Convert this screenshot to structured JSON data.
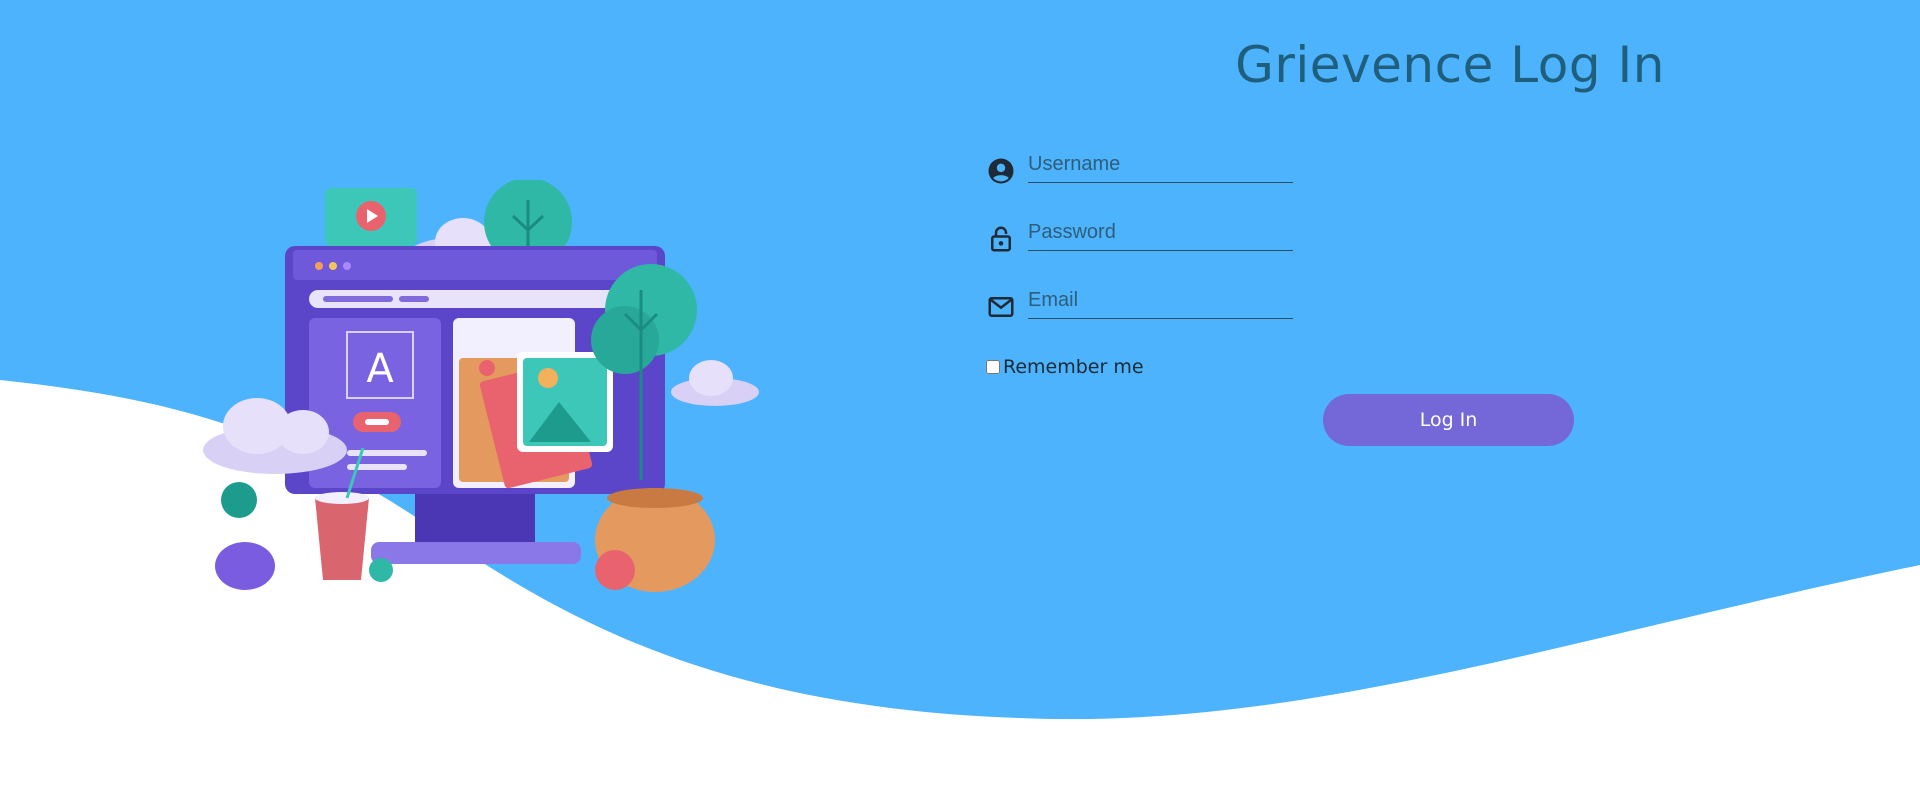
{
  "page": {
    "title": "Grievence Log In"
  },
  "form": {
    "username": {
      "value": "",
      "placeholder": "Username",
      "icon": "account-circle-icon"
    },
    "password": {
      "value": "",
      "placeholder": "Password",
      "icon": "lock-open-icon"
    },
    "email": {
      "value": "",
      "placeholder": "Email",
      "icon": "mail-icon"
    },
    "remember_label": "Remember me",
    "remember_checked": false,
    "login_label": "Log In"
  },
  "illustration": {
    "icon": "website-design-illustration",
    "monitor_letter": "A"
  },
  "colors": {
    "background_blue": "#4db3fd",
    "title": "#1f5f7d",
    "button": "#7467d8",
    "button_text": "#ffffff"
  }
}
